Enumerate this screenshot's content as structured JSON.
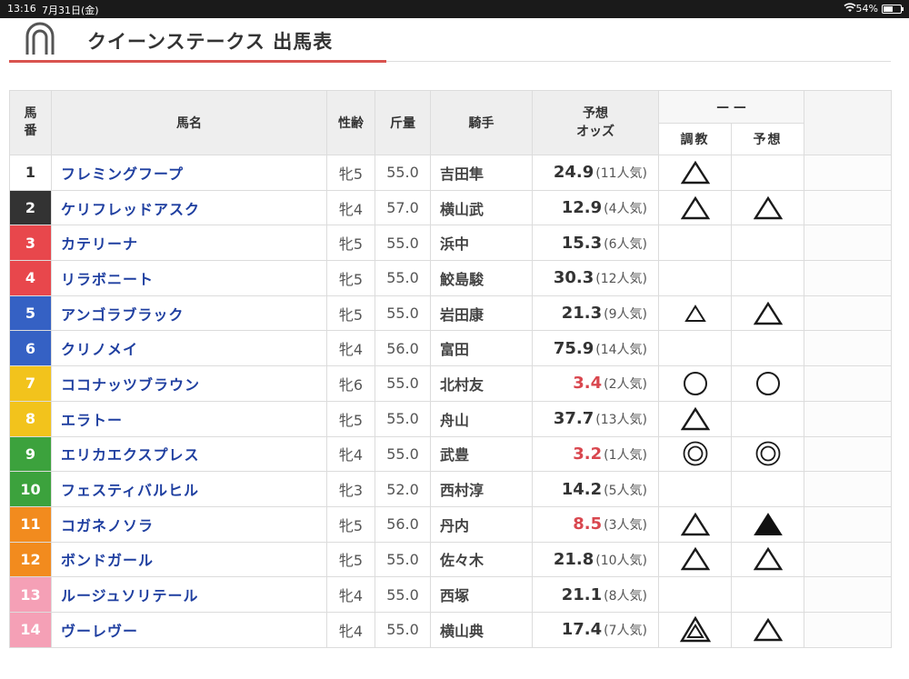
{
  "status_bar": {
    "time": "13:16",
    "date": "7月31日(金)",
    "battery": "54%",
    "battery_level": 0.54
  },
  "page_title": "クイーンステークス 出馬表",
  "headers": {
    "number": "馬番",
    "name": "馬名",
    "sex_age": "性齢",
    "weight": "斤量",
    "jockey": "騎手",
    "odds_line1": "予想",
    "odds_line2": "オッズ",
    "chokyo": "調教",
    "yoso": "予想"
  },
  "colors": {
    "waku": {
      "1": "#ffffff",
      "2": "#333333",
      "3": "#e8474c",
      "4": "#e8474c",
      "5": "#3561c4",
      "6": "#3561c4",
      "7": "#f2c31c",
      "8": "#f2c31c",
      "9": "#3ca23d",
      "10": "#3ca23d",
      "11": "#f28b1e",
      "12": "#f28b1e",
      "13": "#f5a0b6",
      "14": "#f5a0b6"
    },
    "title_accent": "#d9534f",
    "horse_name": "#1f3fa0",
    "favorite_odds": "#d9474f"
  },
  "horses": [
    {
      "num": "1",
      "name": "フレミングフープ",
      "sex_age": "牝5",
      "weight": "55.0",
      "jockey": "吉田隼",
      "odds": "24.9",
      "pop": "(11人気)",
      "fav": false,
      "chokyo": "triangle-icon",
      "yoso": ""
    },
    {
      "num": "2",
      "name": "ケリフレッドアスク",
      "sex_age": "牝4",
      "weight": "57.0",
      "jockey": "横山武",
      "odds": "12.9",
      "pop": "(4人気)",
      "fav": false,
      "chokyo": "triangle-icon",
      "yoso": "triangle-icon"
    },
    {
      "num": "3",
      "name": "カテリーナ",
      "sex_age": "牝5",
      "weight": "55.0",
      "jockey": "浜中",
      "odds": "15.3",
      "pop": "(6人気)",
      "fav": false,
      "chokyo": "",
      "yoso": ""
    },
    {
      "num": "4",
      "name": "リラボニート",
      "sex_age": "牝5",
      "weight": "55.0",
      "jockey": "鮫島駿",
      "odds": "30.3",
      "pop": "(12人気)",
      "fav": false,
      "chokyo": "",
      "yoso": ""
    },
    {
      "num": "5",
      "name": "アンゴラブラック",
      "sex_age": "牝5",
      "weight": "55.0",
      "jockey": "岩田康",
      "odds": "21.3",
      "pop": "(9人気)",
      "fav": false,
      "chokyo": "small-triangle-icon",
      "yoso": "triangle-icon"
    },
    {
      "num": "6",
      "name": "クリノメイ",
      "sex_age": "牝4",
      "weight": "56.0",
      "jockey": "富田",
      "odds": "75.9",
      "pop": "(14人気)",
      "fav": false,
      "chokyo": "",
      "yoso": ""
    },
    {
      "num": "7",
      "name": "ココナッツブラウン",
      "sex_age": "牝6",
      "weight": "55.0",
      "jockey": "北村友",
      "odds": "3.4",
      "pop": "(2人気)",
      "fav": true,
      "chokyo": "circle-icon",
      "yoso": "circle-icon"
    },
    {
      "num": "8",
      "name": "エラトー",
      "sex_age": "牝5",
      "weight": "55.0",
      "jockey": "舟山",
      "odds": "37.7",
      "pop": "(13人気)",
      "fav": false,
      "chokyo": "triangle-icon",
      "yoso": ""
    },
    {
      "num": "9",
      "name": "エリカエクスプレス",
      "sex_age": "牝4",
      "weight": "55.0",
      "jockey": "武豊",
      "odds": "3.2",
      "pop": "(1人気)",
      "fav": true,
      "chokyo": "double-circle-icon",
      "yoso": "double-circle-icon"
    },
    {
      "num": "10",
      "name": "フェスティバルヒル",
      "sex_age": "牝3",
      "weight": "52.0",
      "jockey": "西村淳",
      "odds": "14.2",
      "pop": "(5人気)",
      "fav": false,
      "chokyo": "",
      "yoso": ""
    },
    {
      "num": "11",
      "name": "コガネノソラ",
      "sex_age": "牝5",
      "weight": "56.0",
      "jockey": "丹内",
      "odds": "8.5",
      "pop": "(3人気)",
      "fav": true,
      "chokyo": "triangle-icon",
      "yoso": "filled-triangle-icon"
    },
    {
      "num": "12",
      "name": "ボンドガール",
      "sex_age": "牝5",
      "weight": "55.0",
      "jockey": "佐々木",
      "odds": "21.8",
      "pop": "(10人気)",
      "fav": false,
      "chokyo": "triangle-icon",
      "yoso": "triangle-icon"
    },
    {
      "num": "13",
      "name": "ルージュソリテール",
      "sex_age": "牝4",
      "weight": "55.0",
      "jockey": "西塚",
      "odds": "21.1",
      "pop": "(8人気)",
      "fav": false,
      "chokyo": "",
      "yoso": ""
    },
    {
      "num": "14",
      "name": "ヴーレヴー",
      "sex_age": "牝4",
      "weight": "55.0",
      "jockey": "横山典",
      "odds": "17.4",
      "pop": "(7人気)",
      "fav": false,
      "chokyo": "nested-triangle-icon",
      "yoso": "triangle-icon"
    }
  ]
}
